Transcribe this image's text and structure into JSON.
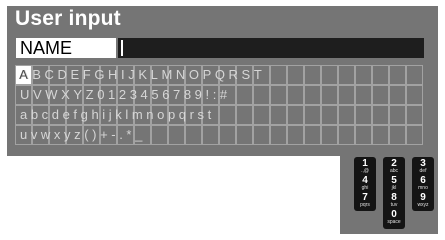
{
  "dialog": {
    "title": "User input",
    "name_label": "NAME",
    "name_value": ""
  },
  "keyboard": {
    "rows": [
      "ABCDEFGHIJKLMNOPQRST",
      "UVWXYZ0123456789!:#",
      "abcdefghijklmnopqrst",
      "uvwxyz()+-.*_"
    ],
    "selected_key": "A"
  },
  "remote_keypad": {
    "keys": [
      {
        "digit": "1",
        "letters": ".,@"
      },
      {
        "digit": "2",
        "letters": "abc"
      },
      {
        "digit": "3",
        "letters": "def"
      },
      {
        "digit": "4",
        "letters": "ghi"
      },
      {
        "digit": "5",
        "letters": "jkl"
      },
      {
        "digit": "6",
        "letters": "mno"
      },
      {
        "digit": "7",
        "letters": "pqrs"
      },
      {
        "digit": "8",
        "letters": "tuv"
      },
      {
        "digit": "9",
        "letters": "wxyz"
      },
      {
        "digit": "0",
        "letters": "space"
      }
    ]
  },
  "colors": {
    "panel": "#757575",
    "grid_line": "#a2a2a2",
    "key_text": "#d6d6d6",
    "highlight": "#ffffff",
    "field": "#1e1e1e"
  }
}
